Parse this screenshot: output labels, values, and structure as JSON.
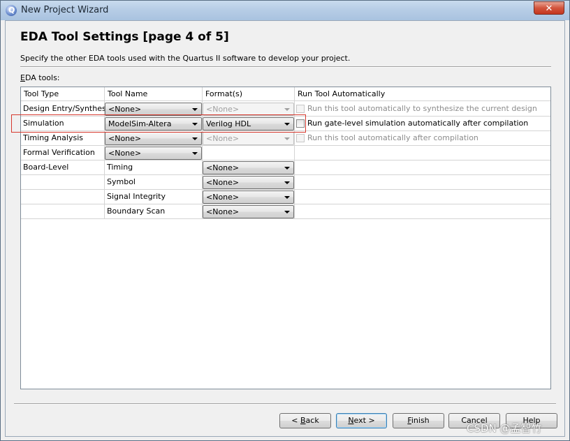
{
  "window": {
    "title": "New Project Wizard",
    "app_icon": "quartus-icon",
    "close_label": "✕"
  },
  "header": {
    "title": "EDA Tool Settings [page 4 of 5]",
    "description": "Specify the other EDA tools used with the Quartus II software to develop your project."
  },
  "section": {
    "label_prefix": "E",
    "label_rest": "DA tools:"
  },
  "table": {
    "columns": [
      "Tool Type",
      "Tool Name",
      "Format(s)",
      "Run Tool Automatically"
    ],
    "rows": [
      {
        "type": "Design Entry/Synthesis",
        "tool": "<None>",
        "format": "<None>",
        "format_disabled": true,
        "run_label": "Run this tool automatically to synthesize the current design",
        "run_disabled": true
      },
      {
        "type": "Simulation",
        "tool": "ModelSim-Altera",
        "format": "Verilog HDL",
        "format_disabled": false,
        "run_label": "Run gate-level simulation automatically after compilation",
        "run_disabled": false
      },
      {
        "type": "Timing Analysis",
        "tool": "<None>",
        "format": "<None>",
        "format_disabled": true,
        "run_label": "Run this tool automatically after compilation",
        "run_disabled": true
      },
      {
        "type": "Formal Verification",
        "tool": "<None>"
      }
    ],
    "board_level": {
      "type": "Board-Level",
      "items": [
        {
          "name": "Timing",
          "format": "<None>"
        },
        {
          "name": "Symbol",
          "format": "<None>"
        },
        {
          "name": "Signal Integrity",
          "format": "<None>"
        },
        {
          "name": "Boundary Scan",
          "format": "<None>"
        }
      ]
    }
  },
  "buttons": {
    "back_prefix": "< ",
    "back_mnemonic": "B",
    "back_rest": "ack",
    "next_mnemonic": "N",
    "next_rest": "ext >",
    "finish_mnemonic": "F",
    "finish_rest": "inish",
    "cancel": "Cancel",
    "help": "Help"
  },
  "watermark": "CSDN @孟智竹"
}
